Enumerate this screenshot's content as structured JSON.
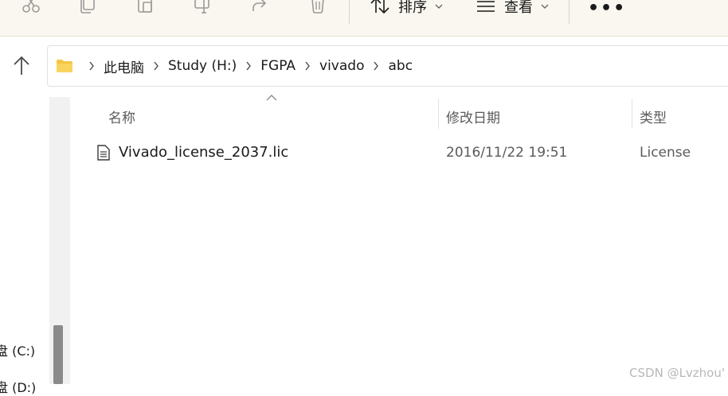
{
  "toolbar": {
    "icons": [
      "cut-icon",
      "copy-icon",
      "paste-icon",
      "rename-icon",
      "share-icon",
      "delete-icon"
    ],
    "sort_label": "排序",
    "view_label": "查看",
    "more_label": "•••"
  },
  "address": {
    "crumbs": [
      "此电脑",
      "Study (H:)",
      "FGPA",
      "vivado",
      "abc"
    ]
  },
  "nav": {
    "items": [
      "盘 (C:)",
      "盘 (D:)"
    ]
  },
  "columns": {
    "name": "名称",
    "date": "修改日期",
    "type": "类型"
  },
  "files": [
    {
      "name": "Vivado_license_2037.lic",
      "date": "2016/11/22 19:51",
      "type": "License"
    }
  ],
  "watermark": "CSDN @Lvzhou'",
  "colors": {
    "toolbar_bg": "#f9f7ef",
    "folder": "#f4c542",
    "scroll_thumb": "#8a8a8a"
  }
}
